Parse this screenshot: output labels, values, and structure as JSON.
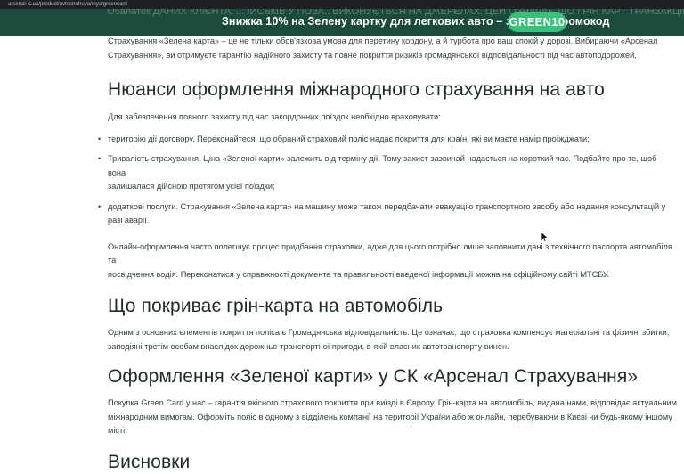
{
  "browser": {
    "url": "arsenal-ic.ua/product/avtostrahuvannya/greencard"
  },
  "promo_banner": {
    "hidden_text": "Обалаток ДАНИХ КЛІЄНТА. ... ІЙСЬКІВ У ПОЗА.. ВИКОНУЄТЬСЯ НА ДЖЕРЕЛАХ. ЦЕЙ ОЗНАЧАЄ ЩО ГРІН КАРТ ТРАНЗАКЦІЙ.",
    "text": "Знижка 10% на Зелену картку для легкових авто – забирай промокод",
    "code": "GREEN10"
  },
  "article": {
    "intro": {
      "line1": "Страхування «Зелена карта» – це не тільки обов'язкова умова для перетину кордону, а й турбота про ваш спокій у дорозі. Вибираючи «Арсенал",
      "line2": "Страхування», ви отримуєте гарантію надійного захисту та повне покриття ризиків громадянської відповідальності під час автоподорожей."
    },
    "section1": {
      "heading": "Нюанси оформлення міжнародного страхування на авто",
      "lead": "Для забезпечення повного захисту під час закордонних поїздок необхідно враховувати:",
      "bullets": [
        {
          "line1": "територію дії договору. Переконайтеся, що обраний страховий поліс надає покриття для країн, які ви маєте намір проїжджати;",
          "line2": ""
        },
        {
          "line1": "Тривалість страхування. Ціна «Зеленої карти» залежить від терміну дії. Тому захист зазвичай надається на короткий час. Подбайте про те, щоб вона",
          "line2": "залишалася дійсною протягом усієї поїздки;"
        },
        {
          "line1": "додаткові послуги. Страхування «Зелена карта» на машину може також передбачати евакуацію транспортного засобу або надання консультацій у",
          "line2": "разі аварії."
        }
      ],
      "outro_line1": "Онлайн-оформлення часто полегшує процес придбання страховки, адже для цього потрібно лише заповнити дані з технічного паспорта автомобіля та",
      "outro_line2": "посвідчення водія. Переконатися у справжності документа та правильності введеної інформації можна на офіційному сайті МТСБУ."
    },
    "section2": {
      "heading": "Що покриває грін-карта на автомобіль",
      "line1": "Одним з основних елементів покриття поліса є Громадянська відповідальність. Це означає, що страховка компенсує матеріальні та фізичні збитки,",
      "line2": "заподіяні третім особам внаслідок дорожньо-транспортної пригоди, в якій власник автотранспорту винен."
    },
    "section3": {
      "heading": "Оформлення «Зеленої карти» у СК «Арсенал Страхування»",
      "line1": "Покупка Green Card у нас – гарантія якісного страхового покриття при виїзді в Європу. Грін-карта на автомобіль, видана нами, відповідає актуальним",
      "line2": "міжнародним вимогам. Оформіть поліс в одному з відділень компанії на території України або ж онлайн, перебуваючи в Києві чи будь-якому іншому місті."
    },
    "section4": {
      "heading": "Висновки"
    }
  },
  "icons": {
    "bullet": "•",
    "cursor": "mouse-pointer-icon"
  },
  "colors": {
    "banner_bg": "#1c4a3d",
    "code_badge_bg": "#39c07a",
    "heading_text": "#1f2b27",
    "body_text": "#33413c"
  }
}
